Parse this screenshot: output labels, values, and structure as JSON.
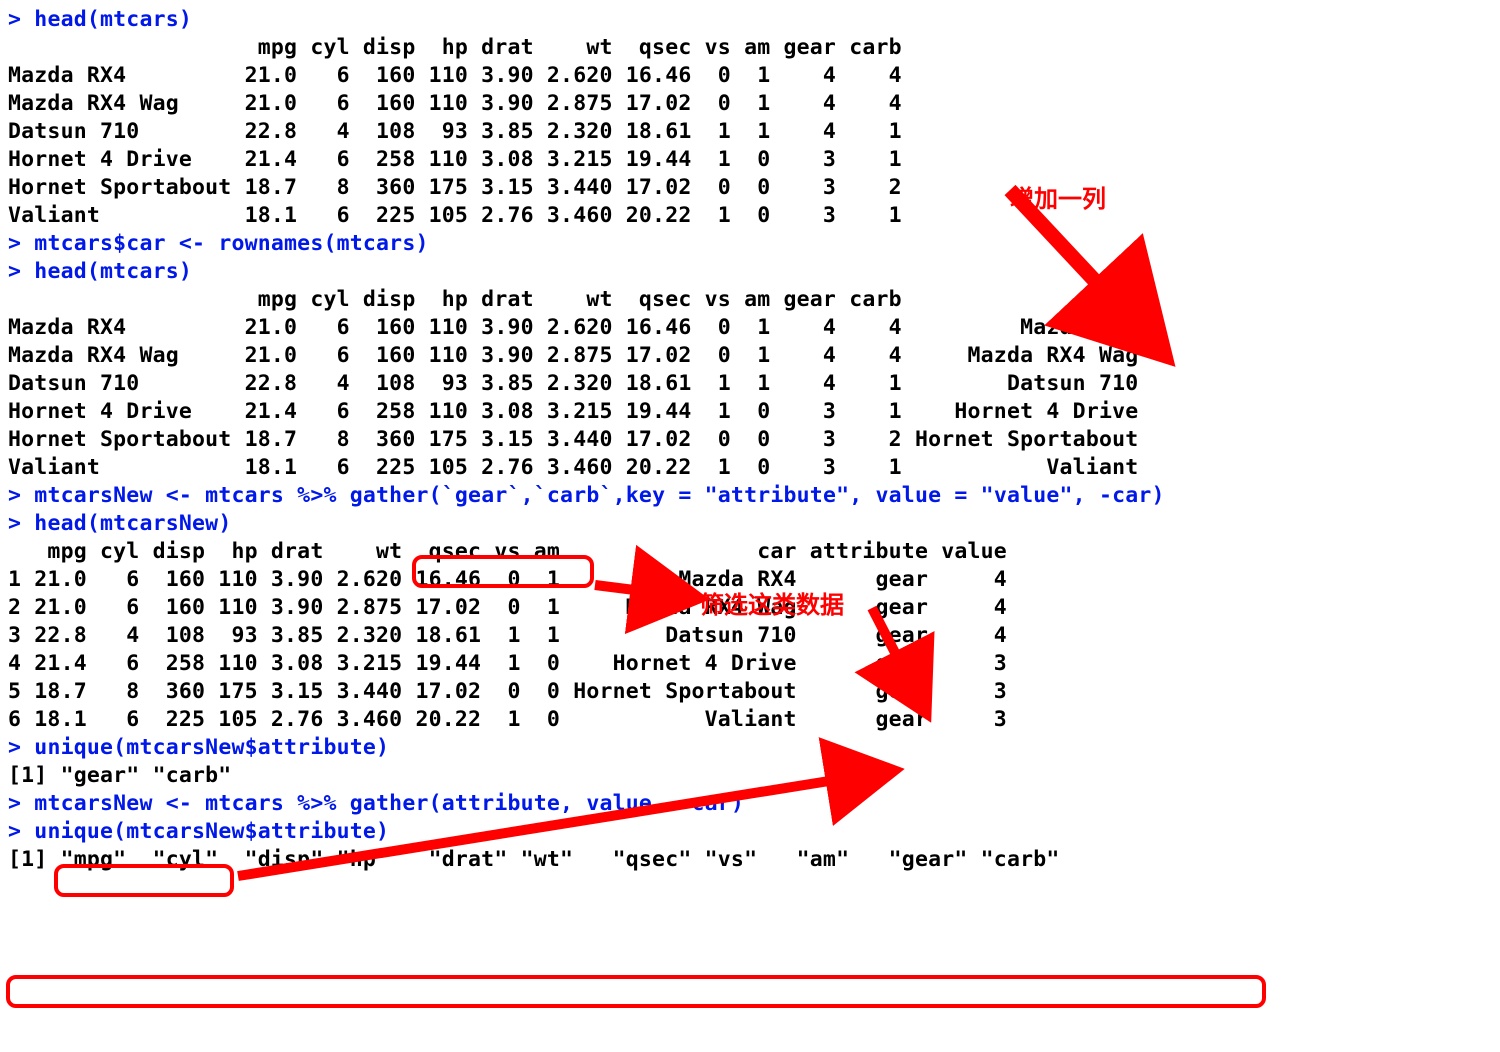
{
  "commands": {
    "c1": "head(mtcars)",
    "c2": "mtcars$car <- rownames(mtcars)",
    "c3": "head(mtcars)",
    "c4_a": "mtcarsNew <- mtcars %>% gather(",
    "c4_b": "`gear`,`carb`",
    "c4_c": ",key = \"attribute\", value = \"value\", -car)",
    "c5": "head(mtcarsNew)",
    "c6": "unique(mtcarsNew$attribute)",
    "c7": "mtcarsNew <- mtcars %>% gather(attribute, value, -car)",
    "c8": "unique(mtcarsNew$attribute)"
  },
  "headers1": "                   mpg cyl disp  hp drat    wt  qsec vs am gear carb",
  "table1": [
    "Mazda RX4         21.0   6  160 110 3.90 2.620 16.46  0  1    4    4",
    "Mazda RX4 Wag     21.0   6  160 110 3.90 2.875 17.02  0  1    4    4",
    "Datsun 710        22.8   4  108  93 3.85 2.320 18.61  1  1    4    1",
    "Hornet 4 Drive    21.4   6  258 110 3.08 3.215 19.44  1  0    3    1",
    "Hornet Sportabout 18.7   8  360 175 3.15 3.440 17.02  0  0    3    2",
    "Valiant           18.1   6  225 105 2.76 3.460 20.22  1  0    3    1"
  ],
  "headers2": "                   mpg cyl disp  hp drat    wt  qsec vs am gear carb               car",
  "table2": [
    "Mazda RX4         21.0   6  160 110 3.90 2.620 16.46  0  1    4    4         Mazda RX4",
    "Mazda RX4 Wag     21.0   6  160 110 3.90 2.875 17.02  0  1    4    4     Mazda RX4 Wag",
    "Datsun 710        22.8   4  108  93 3.85 2.320 18.61  1  1    4    1        Datsun 710",
    "Hornet 4 Drive    21.4   6  258 110 3.08 3.215 19.44  1  0    3    1    Hornet 4 Drive",
    "Hornet Sportabout 18.7   8  360 175 3.15 3.440 17.02  0  0    3    2 Hornet Sportabout",
    "Valiant           18.1   6  225 105 2.76 3.460 20.22  1  0    3    1           Valiant"
  ],
  "headers3": "   mpg cyl disp  hp drat    wt  qsec vs am               car attribute value",
  "table3": [
    "1 21.0   6  160 110 3.90 2.620 16.46  0  1         Mazda RX4      gear     4",
    "2 21.0   6  160 110 3.90 2.875 17.02  0  1     Mazda RX4 Wag      gear     4",
    "3 22.8   4  108  93 3.85 2.320 18.61  1  1        Datsun 710      gear     4",
    "4 21.4   6  258 110 3.08 3.215 19.44  1  0    Hornet 4 Drive      gear     3",
    "5 18.7   8  360 175 3.15 3.440 17.02  0  0 Hornet Sportabout      gear     3",
    "6 18.1   6  225 105 2.76 3.460 20.22  1  0           Valiant      gear     3"
  ],
  "unique1": "[1] \"gear\" \"carb\"",
  "unique2": "[1] \"mpg\"  \"cyl\"  \"disp\" \"hp\"   \"drat\" \"wt\"   \"qsec\" \"vs\"   \"am\"   \"gear\" \"carb\"",
  "annotations": {
    "add_column": "增加一列",
    "filter_data": "筛选这类数据"
  }
}
